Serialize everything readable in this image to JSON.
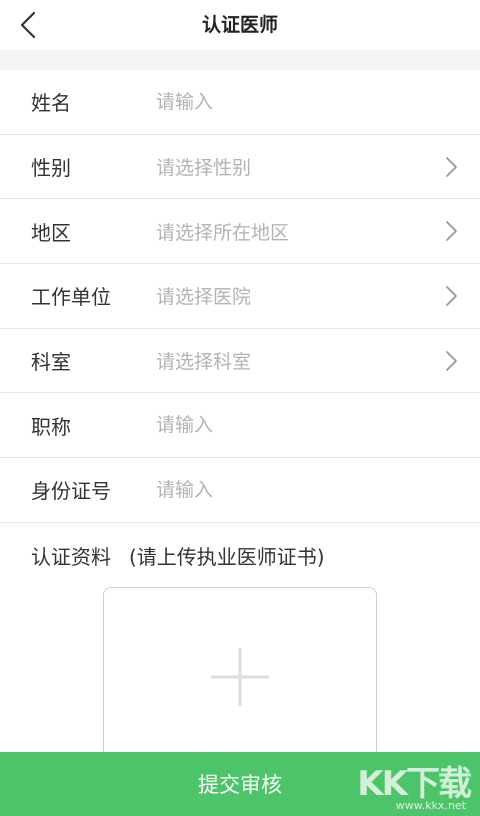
{
  "header": {
    "title": "认证医师",
    "back_icon": "chevron-left-icon"
  },
  "form": {
    "rows": [
      {
        "label": "姓名",
        "placeholder": "请输入",
        "type": "input"
      },
      {
        "label": "性别",
        "placeholder": "请选择性别",
        "type": "select"
      },
      {
        "label": "地区",
        "placeholder": "请选择所在地区",
        "type": "select"
      },
      {
        "label": "工作单位",
        "placeholder": "请选择医院",
        "type": "select"
      },
      {
        "label": "科室",
        "placeholder": "请选择科室",
        "type": "select"
      },
      {
        "label": "职称",
        "placeholder": "请输入",
        "type": "input"
      },
      {
        "label": "身份证号",
        "placeholder": "请输入",
        "type": "input"
      }
    ]
  },
  "upload": {
    "label": "认证资料",
    "hint": "(请上传执业医师证书)",
    "icon": "plus-icon"
  },
  "submit": {
    "label": "提交审核",
    "color": "#4dc46a"
  },
  "watermark": {
    "logo": "KK下载",
    "url": "www.kkx.net"
  },
  "colors": {
    "placeholder": "#b3b3b3",
    "divider": "#e6e6e6",
    "gap": "#f4f4f4"
  }
}
